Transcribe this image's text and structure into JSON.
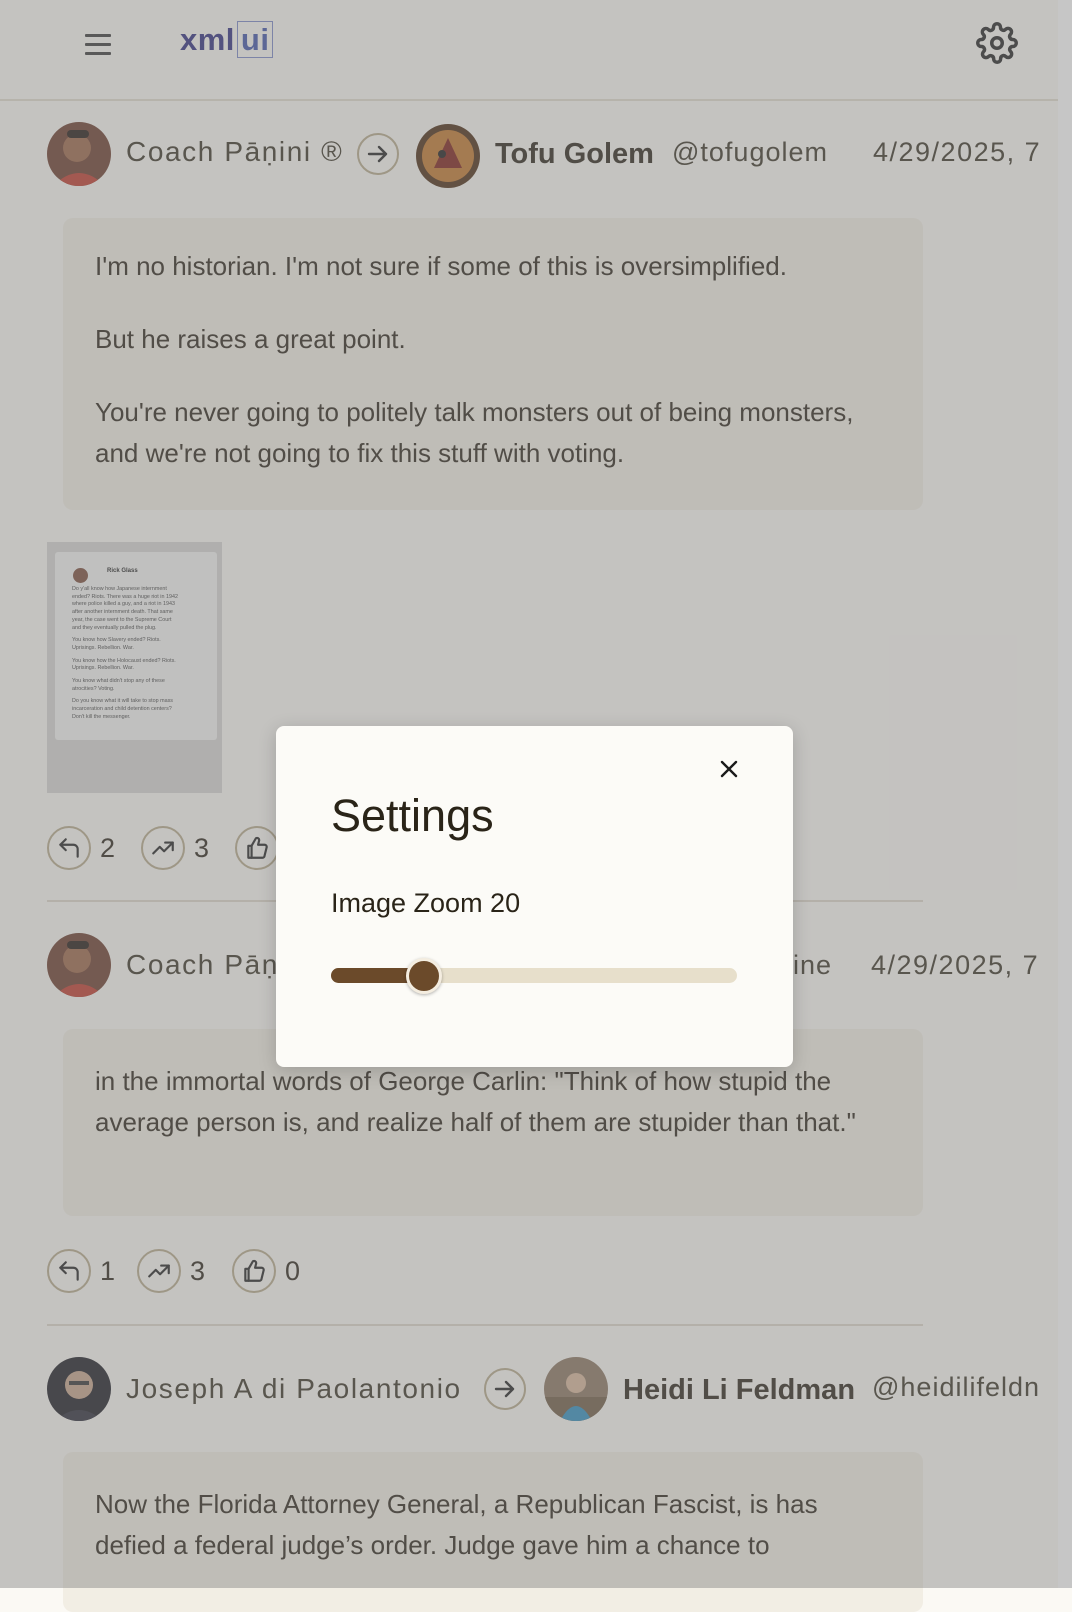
{
  "header": {
    "logo_xml": "xml",
    "logo_ui": "ui"
  },
  "posts": [
    {
      "author": "Coach Pāṇini ®",
      "target_name": "Tofu Golem",
      "handle": "@tofugolem",
      "date": "4/29/2025, 7",
      "paragraphs": [
        "I'm no historian. I'm not sure if some of this is oversimplified.",
        "But he raises a great point.",
        "You're never going to politely talk monsters out of being monsters, and we're not going to fix this stuff with voting."
      ],
      "image": {
        "name": "Rick Glass",
        "lines": [
          "Do y'all know how Japanese internment",
          "ended? Riots. There was a huge riot in 1942",
          "where police killed a guy, and a riot in 1943",
          "after another internment death. That same",
          "year, the case went to the Supreme Court",
          "and they eventually pulled the plug.",
          "",
          "You know how Slavery ended? Riots.",
          "Uprisings. Rebellion. War.",
          "",
          "You know how the Holocaust ended? Riots.",
          "Uprisings. Rebellion. War.",
          "",
          "You know what didn't stop any of these",
          "atrocities? Voting.",
          "",
          "Do you know what it will take to stop mass",
          "incarceration and child detention centers?",
          "Don't kill the messenger."
        ]
      },
      "replies": "2",
      "reposts": "3"
    },
    {
      "author": "Coach Pāṇ",
      "handle_tail": "ine",
      "date": "4/29/2025, 7",
      "paragraphs": [
        "in the immortal words of George Carlin: \"Think of how stupid the average person is, and realize half of them are stupider than that.\""
      ],
      "replies": "1",
      "reposts": "3",
      "likes": "0"
    },
    {
      "author": "Joseph A di Paolantonio",
      "target_name": "Heidi Li Feldman",
      "handle": "@heidilifeldn",
      "paragraphs": [
        "Now the Florida Attorney General, a Republican Fascist, is has defied a federal judge’s order. Judge gave him a chance to"
      ]
    }
  ],
  "settings_modal": {
    "title": "Settings",
    "zoom_label": "Image Zoom 20",
    "zoom_fraction": 0.23
  },
  "colors": {
    "accent": "#6b4a2a",
    "track": "#e7dfcb",
    "logo": "#2f2c7e",
    "card": "#f2eee4"
  }
}
